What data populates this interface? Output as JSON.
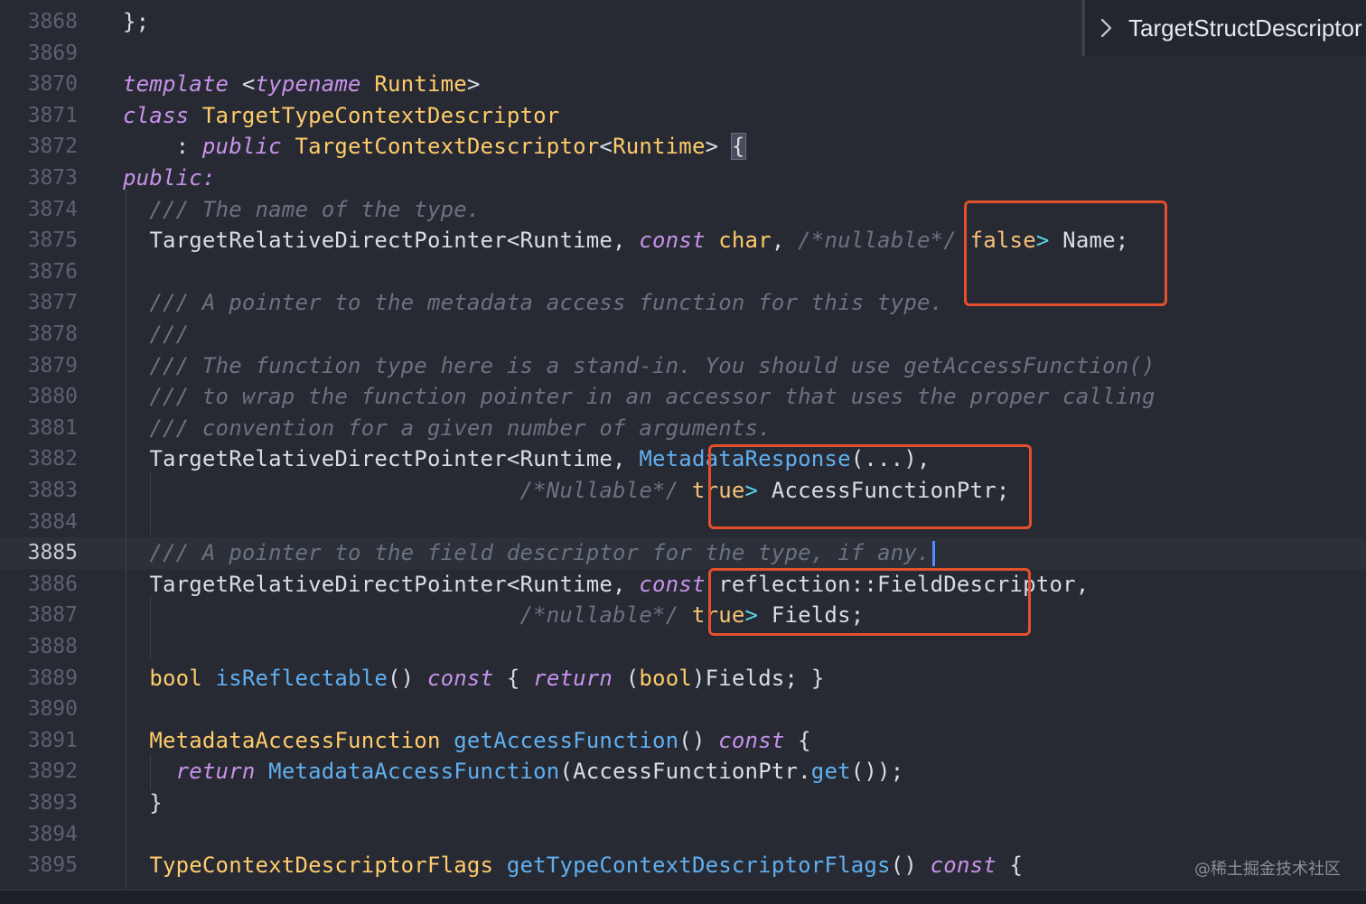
{
  "outline": {
    "breadcrumb_label": "TargetStructDescriptor"
  },
  "watermark": "@稀土掘金技术社区",
  "editor": {
    "current_line": "3885",
    "lines": [
      {
        "n": "3868",
        "tokens": [
          [
            "pn",
            "};"
          ]
        ]
      },
      {
        "n": "3869",
        "tokens": []
      },
      {
        "n": "3870",
        "tokens": [
          [
            "kw",
            "template"
          ],
          [
            "pn",
            " <"
          ],
          [
            "kw",
            "typename"
          ],
          [
            "type",
            " Runtime"
          ],
          [
            "pn",
            ">"
          ]
        ]
      },
      {
        "n": "3871",
        "tokens": [
          [
            "kw",
            "class"
          ],
          [
            "type",
            " TargetTypeContextDescriptor"
          ]
        ]
      },
      {
        "n": "3872",
        "tokens": [
          [
            "pn",
            "    : "
          ],
          [
            "kw",
            "public"
          ],
          [
            "type",
            " TargetContextDescriptor"
          ],
          [
            "pn",
            "<"
          ],
          [
            "type",
            "Runtime"
          ],
          [
            "pn",
            "> "
          ],
          [
            "brace",
            "{"
          ]
        ]
      },
      {
        "n": "3873",
        "tokens": [
          [
            "kw",
            "public:"
          ]
        ]
      },
      {
        "n": "3874",
        "tokens": [
          [
            "pn",
            "  "
          ],
          [
            "cm",
            "/// The name of the type."
          ]
        ]
      },
      {
        "n": "3875",
        "tokens": [
          [
            "pn",
            "  "
          ],
          [
            "plain",
            "TargetRelativeDirectPointer"
          ],
          [
            "pn",
            "<"
          ],
          [
            "plain",
            "Runtime, "
          ],
          [
            "kw",
            "const"
          ],
          [
            "type",
            " char"
          ],
          [
            "pn",
            ", "
          ],
          [
            "cm",
            "/*nullable*/"
          ],
          [
            "bool",
            " false"
          ],
          [
            "op",
            ">"
          ],
          [
            "plain",
            " Name;"
          ]
        ]
      },
      {
        "n": "3876",
        "tokens": []
      },
      {
        "n": "3877",
        "tokens": [
          [
            "pn",
            "  "
          ],
          [
            "cm",
            "/// A pointer to the metadata access function for this type."
          ]
        ]
      },
      {
        "n": "3878",
        "tokens": [
          [
            "pn",
            "  "
          ],
          [
            "cm",
            "///"
          ]
        ]
      },
      {
        "n": "3879",
        "tokens": [
          [
            "pn",
            "  "
          ],
          [
            "cm",
            "/// The function type here is a stand-in. You should use getAccessFunction()"
          ]
        ]
      },
      {
        "n": "3880",
        "tokens": [
          [
            "pn",
            "  "
          ],
          [
            "cm",
            "/// to wrap the function pointer in an accessor that uses the proper calling"
          ]
        ]
      },
      {
        "n": "3881",
        "tokens": [
          [
            "pn",
            "  "
          ],
          [
            "cm",
            "/// convention for a given number of arguments."
          ]
        ]
      },
      {
        "n": "3882",
        "tokens": [
          [
            "pn",
            "  "
          ],
          [
            "plain",
            "TargetRelativeDirectPointer"
          ],
          [
            "pn",
            "<"
          ],
          [
            "plain",
            "Runtime, "
          ],
          [
            "fn",
            "MetadataResponse"
          ],
          [
            "pn",
            "(...),"
          ]
        ]
      },
      {
        "n": "3883",
        "tokens": [
          [
            "pn",
            "                              "
          ],
          [
            "cm",
            "/*Nullable*/"
          ],
          [
            "bool",
            " true"
          ],
          [
            "op",
            ">"
          ],
          [
            "plain",
            " AccessFunctionPtr;"
          ]
        ]
      },
      {
        "n": "3884",
        "tokens": []
      },
      {
        "n": "3885",
        "tokens": [
          [
            "pn",
            "  "
          ],
          [
            "cm",
            "/// A pointer to the field descriptor for the type, if any."
          ],
          [
            "cursor",
            ""
          ]
        ]
      },
      {
        "n": "3886",
        "tokens": [
          [
            "pn",
            "  "
          ],
          [
            "plain",
            "TargetRelativeDirectPointer"
          ],
          [
            "pn",
            "<"
          ],
          [
            "plain",
            "Runtime, "
          ],
          [
            "kw",
            "const"
          ],
          [
            "plain",
            " reflection::FieldDescriptor,"
          ]
        ]
      },
      {
        "n": "3887",
        "tokens": [
          [
            "pn",
            "                              "
          ],
          [
            "cm",
            "/*nullable*/"
          ],
          [
            "bool",
            " true"
          ],
          [
            "op",
            ">"
          ],
          [
            "plain",
            " Fields;"
          ]
        ]
      },
      {
        "n": "3888",
        "tokens": []
      },
      {
        "n": "3889",
        "tokens": [
          [
            "pn",
            "  "
          ],
          [
            "type",
            "bool"
          ],
          [
            "fn",
            " isReflectable"
          ],
          [
            "pn",
            "() "
          ],
          [
            "kw",
            "const"
          ],
          [
            "pn",
            " { "
          ],
          [
            "kw",
            "return"
          ],
          [
            "pn",
            " ("
          ],
          [
            "type",
            "bool"
          ],
          [
            "plain",
            ")Fields; }"
          ]
        ]
      },
      {
        "n": "3890",
        "tokens": []
      },
      {
        "n": "3891",
        "tokens": [
          [
            "pn",
            "  "
          ],
          [
            "type",
            "MetadataAccessFunction"
          ],
          [
            "fn",
            " getAccessFunction"
          ],
          [
            "pn",
            "() "
          ],
          [
            "kw",
            "const"
          ],
          [
            "pn",
            " {"
          ]
        ]
      },
      {
        "n": "3892",
        "tokens": [
          [
            "pn",
            "    "
          ],
          [
            "kw",
            "return"
          ],
          [
            "fn",
            " MetadataAccessFunction"
          ],
          [
            "plain",
            "(AccessFunctionPtr."
          ],
          [
            "fn",
            "get"
          ],
          [
            "pn",
            "());"
          ]
        ]
      },
      {
        "n": "3893",
        "tokens": [
          [
            "pn",
            "  }"
          ]
        ]
      },
      {
        "n": "3894",
        "tokens": []
      },
      {
        "n": "3895",
        "tokens": [
          [
            "pn",
            "  "
          ],
          [
            "type",
            "TypeContextDescriptorFlags"
          ],
          [
            "fn",
            " getTypeContextDescriptorFlags"
          ],
          [
            "pn",
            "() "
          ],
          [
            "kw",
            "const"
          ],
          [
            "pn",
            " {"
          ]
        ]
      }
    ]
  },
  "colors": {
    "background": "#272a33",
    "highlight_box": "#e5502c",
    "keyword": "#c792ea",
    "type": "#ffcb6b",
    "function": "#61afef",
    "comment": "#6b7280",
    "cursor": "#528bff"
  }
}
